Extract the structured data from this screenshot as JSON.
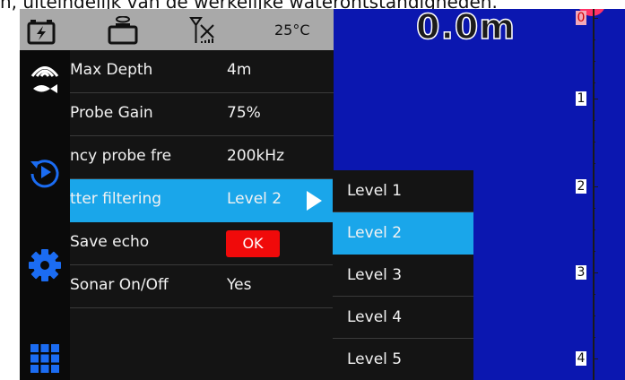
{
  "caption": "n, uiteindelijk van de werkelijke waterontstandigheden.",
  "status": {
    "temperature": "25°C"
  },
  "menu": {
    "items": [
      {
        "label": "Max Depth",
        "value": "4m"
      },
      {
        "label": "Probe Gain",
        "value": "75%"
      },
      {
        "label": "ncy   probe fre",
        "value": "200kHz"
      },
      {
        "label": "tter filtering",
        "value": "Level 2"
      },
      {
        "label": "Save echo",
        "button": "OK"
      },
      {
        "label": "Sonar On/Off",
        "value": "Yes"
      }
    ]
  },
  "submenu": {
    "items": [
      "Level 1",
      "Level 2",
      "Level 3",
      "Level 4",
      "Level 5"
    ],
    "selected": "Level 2"
  },
  "depth_readout": "0.0m",
  "scale_labels": [
    "0",
    "1",
    "2",
    "3",
    "4"
  ],
  "colors": {
    "screen_bg": "#0b17b0",
    "highlight": "#1aa6ea",
    "ok_button": "#f00a0a",
    "status_bar": "#a9a9a9",
    "sidebar_icons": "#1b6cf2"
  },
  "sidebar_icons": [
    "sonar-fish-icon",
    "replay-icon",
    "settings-gear-icon",
    "grid-apps-icon"
  ],
  "status_icons": [
    "battery-charging-icon",
    "sonar-probe-battery-icon",
    "no-signal-icon"
  ]
}
